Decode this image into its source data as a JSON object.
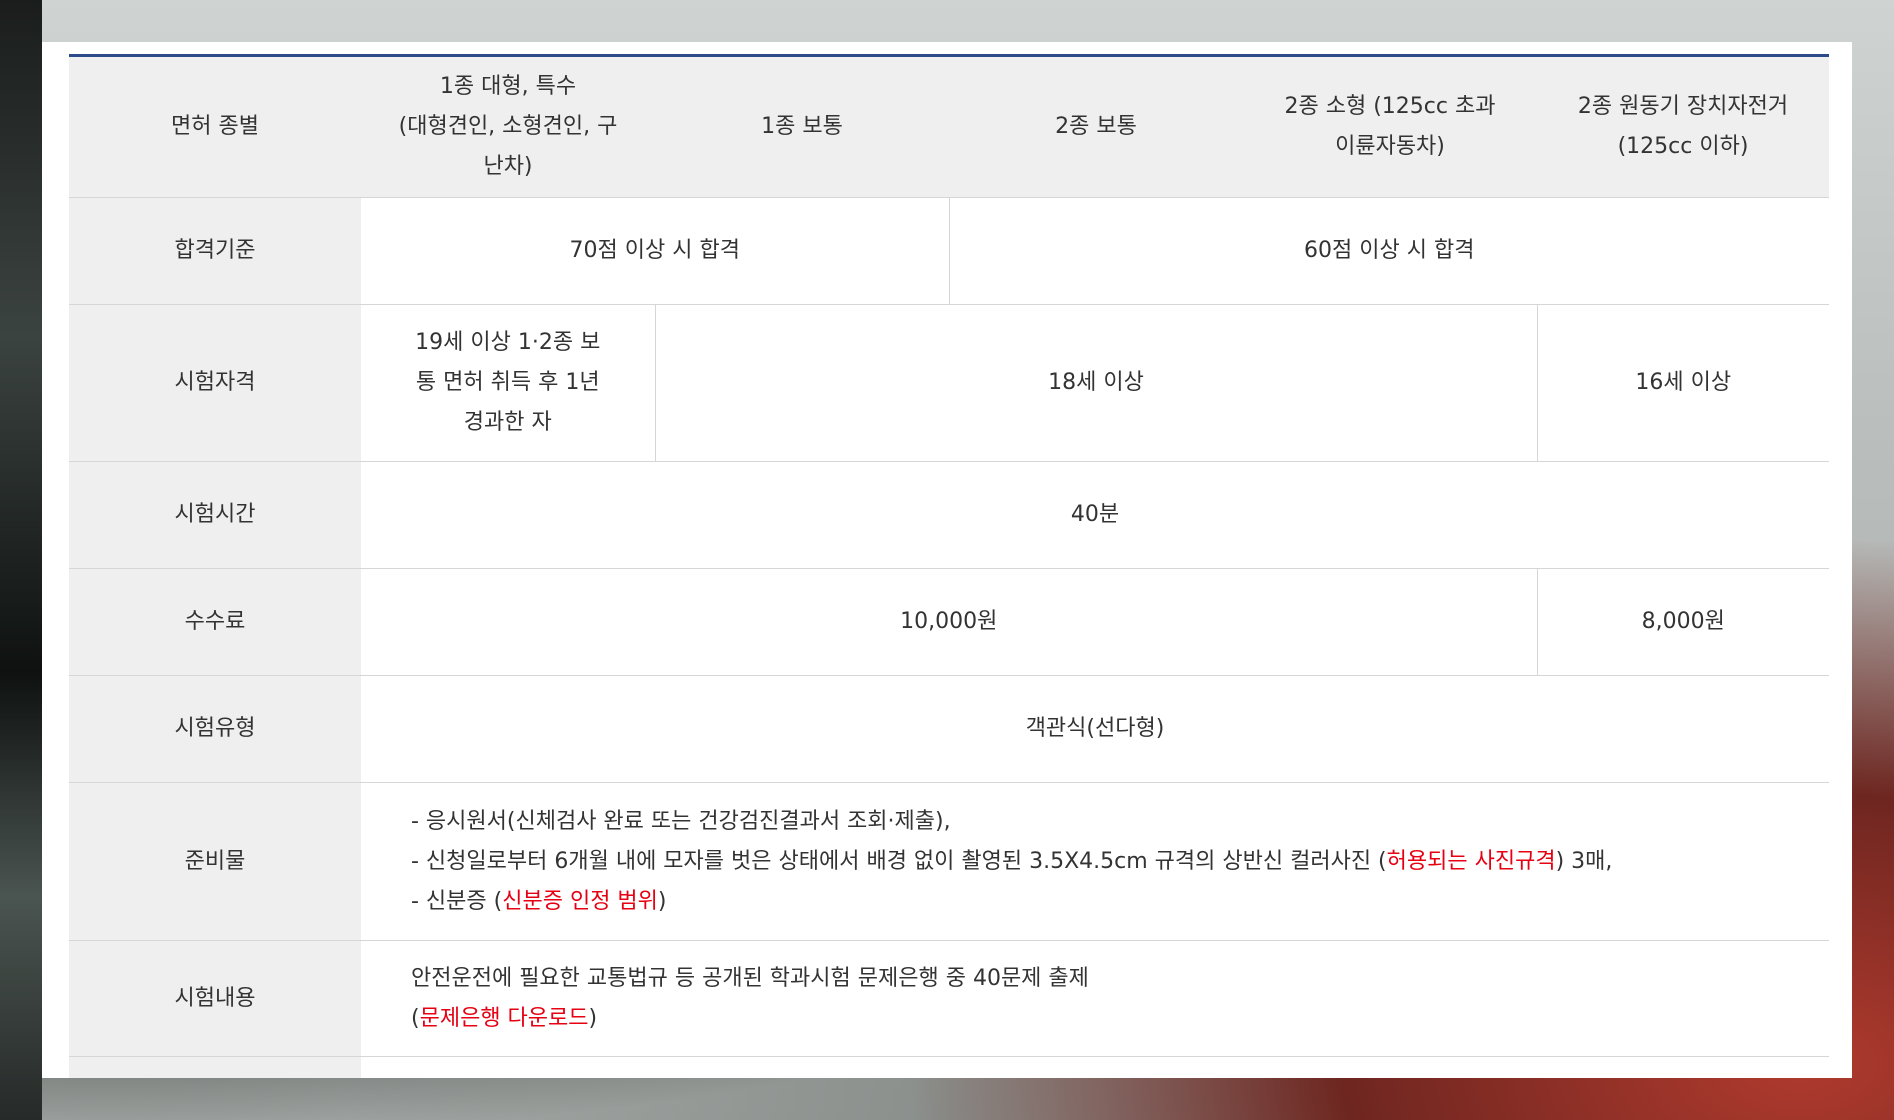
{
  "header": {
    "label": "면허 종별",
    "columns": [
      [
        "1종 대형, 특수",
        "(대형견인, 소형견인, 구",
        "난차)"
      ],
      [
        "1종 보통"
      ],
      [
        "2종 보통"
      ],
      [
        "2종 소형 (125cc 초과",
        "이륜자동차)"
      ],
      [
        "2종 원동기 장치자전거",
        "(125cc 이하)"
      ]
    ]
  },
  "rows": {
    "pass": {
      "label": "합격기준",
      "a": "70점 이상 시 합격",
      "b": "60점 이상 시 합격"
    },
    "eligibility": {
      "label": "시험자격",
      "a": [
        "19세 이상 1·2종 보",
        "통 면허 취득 후 1년",
        "경과한 자"
      ],
      "b": "18세 이상",
      "c": "16세 이상"
    },
    "time": {
      "label": "시험시간",
      "value": "40분"
    },
    "fee": {
      "label": "수수료",
      "a": "10,000원",
      "b": "8,000원"
    },
    "type": {
      "label": "시험유형",
      "value": "객관식(선다형)"
    },
    "prep": {
      "label": "준비물",
      "line1": "- 응시원서(신체검사 완료 또는 건강검진결과서 조회·제출),",
      "line2_pre": "- 신청일로부터 6개월 내에 모자를 벗은 상태에서 배경 없이 촬영된 3.5X4.5cm 규격의 상반신 컬러사진 (",
      "line2_link": "허용되는 사진규격",
      "line2_post": ") 3매,",
      "line3_pre": "- 신분증 (",
      "line3_link": "신분증 인정 범위",
      "line3_post": ")"
    },
    "content": {
      "label": "시험내용",
      "line1": "안전운전에 필요한 교통법규 등 공개된 학과시험 문제은행 중 40문제 출제",
      "line2_pre": "(",
      "line2_link": "문제은행 다운로드",
      "line2_post": ")"
    }
  },
  "colors": {
    "accent": "#2c4a8c",
    "link": "#e60012",
    "header_bg": "#efefef"
  }
}
